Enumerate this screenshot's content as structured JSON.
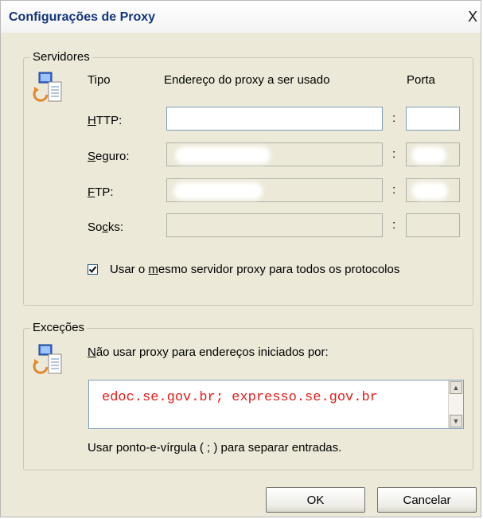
{
  "window": {
    "title": "Configurações de Proxy",
    "close_glyph": "X"
  },
  "servers": {
    "group_label": "Servidores",
    "header": {
      "type": "Tipo",
      "address": "Endereço do proxy a ser usado",
      "port": "Porta"
    },
    "rows": [
      {
        "label": "HTTP:",
        "accel": "H",
        "rest": "TTP:",
        "enabled": true,
        "address": "",
        "port": ""
      },
      {
        "label": "Seguro:",
        "accel": "S",
        "rest": "eguro:",
        "enabled": false,
        "address": "",
        "port": ""
      },
      {
        "label": "FTP:",
        "accel": "F",
        "rest": "TP:",
        "enabled": false,
        "address": "",
        "port": ""
      },
      {
        "label": "Socks:",
        "pre": "So",
        "accel": "c",
        "rest": "ks:",
        "enabled": false,
        "address": "",
        "port": ""
      }
    ],
    "colon": ":",
    "same_proxy": {
      "checked": true,
      "pre": "Usar o ",
      "accel": "m",
      "rest": "esmo servidor proxy para todos os protocolos"
    }
  },
  "exceptions": {
    "group_label": "Exceções",
    "instruction": {
      "accel": "N",
      "rest": "ão usar proxy para endereços iniciados por:"
    },
    "value": "edoc.se.gov.br; expresso.se.gov.br",
    "hint": "Usar ponto-e-vírgula ( ; ) para separar entradas."
  },
  "buttons": {
    "ok": "OK",
    "cancel": "Cancelar"
  },
  "colors": {
    "title": "#13367a",
    "exceptions_text": "#e41b1b",
    "dialog_bg": "#ece9d8"
  }
}
